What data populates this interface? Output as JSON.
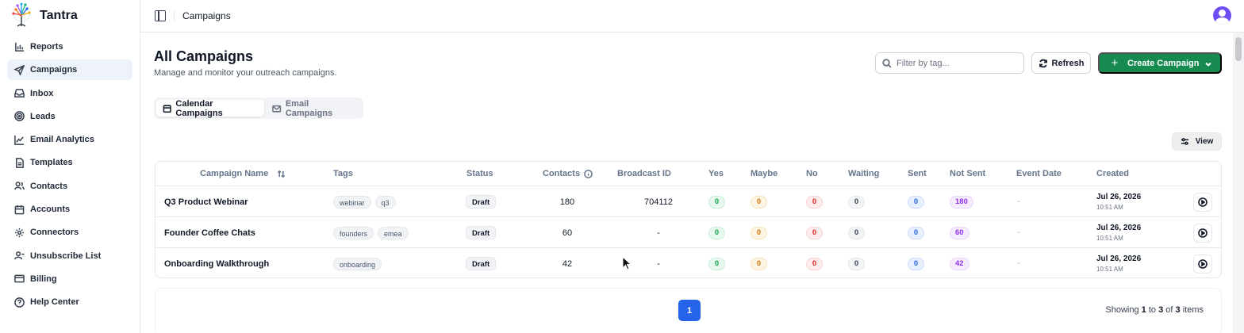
{
  "brand": {
    "name": "Tantra"
  },
  "sidebar": {
    "items": [
      {
        "label": "Reports",
        "icon": "bar-chart-icon",
        "active": false
      },
      {
        "label": "Campaigns",
        "icon": "send-icon",
        "active": true
      },
      {
        "label": "Inbox",
        "icon": "inbox-icon",
        "active": false
      },
      {
        "label": "Leads",
        "icon": "target-icon",
        "active": false
      },
      {
        "label": "Email Analytics",
        "icon": "line-chart-icon",
        "active": false
      },
      {
        "label": "Templates",
        "icon": "document-icon",
        "active": false
      },
      {
        "label": "Contacts",
        "icon": "users-icon",
        "active": false
      },
      {
        "label": "Accounts",
        "icon": "calendar-icon",
        "active": false
      },
      {
        "label": "Connectors",
        "icon": "gear-icon",
        "active": false
      },
      {
        "label": "Unsubscribe List",
        "icon": "user-minus-icon",
        "active": false
      },
      {
        "label": "Billing",
        "icon": "credit-card-icon",
        "active": false
      },
      {
        "label": "Help Center",
        "icon": "help-circle-icon",
        "active": false
      }
    ]
  },
  "topbar": {
    "breadcrumb": "Campaigns"
  },
  "header": {
    "title": "All Campaigns",
    "subtitle": "Manage and monitor your outreach campaigns.",
    "search_placeholder": "Filter by tag...",
    "refresh_label": "Refresh",
    "create_label": "Create Campaign"
  },
  "tabs": [
    {
      "label": "Calendar Campaigns",
      "active": true
    },
    {
      "label": "Email Campaigns",
      "active": false
    }
  ],
  "view_label": "View",
  "table": {
    "columns": [
      "Campaign Name",
      "Tags",
      "Status",
      "Contacts",
      "Broadcast ID",
      "Yes",
      "Maybe",
      "No",
      "Waiting",
      "Sent",
      "Not Sent",
      "Event Date",
      "Created"
    ],
    "rows": [
      {
        "name": "Q3 Product Webinar",
        "tags": [
          "webinar",
          "q3"
        ],
        "status": "Draft",
        "contacts": "180",
        "broadcast_id": "704112",
        "yes": "0",
        "maybe": "0",
        "no": "0",
        "waiting": "0",
        "sent": "0",
        "not_sent": "180",
        "event_date": "-",
        "created_date": "Jul 26, 2026",
        "created_time": "10:51 AM"
      },
      {
        "name": "Founder Coffee Chats",
        "tags": [
          "founders",
          "emea"
        ],
        "status": "Draft",
        "contacts": "60",
        "broadcast_id": "-",
        "yes": "0",
        "maybe": "0",
        "no": "0",
        "waiting": "0",
        "sent": "0",
        "not_sent": "60",
        "event_date": "-",
        "created_date": "Jul 26, 2026",
        "created_time": "10:51 AM"
      },
      {
        "name": "Onboarding Walkthrough",
        "tags": [
          "onboarding"
        ],
        "status": "Draft",
        "contacts": "42",
        "broadcast_id": "-",
        "yes": "0",
        "maybe": "0",
        "no": "0",
        "waiting": "0",
        "sent": "0",
        "not_sent": "42",
        "event_date": "-",
        "created_date": "Jul 26, 2026",
        "created_time": "10:51 AM"
      }
    ]
  },
  "pagination": {
    "current_page": "1",
    "showing_prefix": "Showing",
    "from": "1",
    "to_word": "to",
    "to": "3",
    "of_word": "of",
    "total": "3",
    "suffix": "items"
  },
  "colors": {
    "primary_green": "#168a4f",
    "page_blue": "#2563eb",
    "yes_green": "#16a34a",
    "maybe_amber": "#d97706",
    "no_red": "#dc2626",
    "sent_blue": "#2563eb",
    "not_sent_purple": "#9333ea"
  }
}
